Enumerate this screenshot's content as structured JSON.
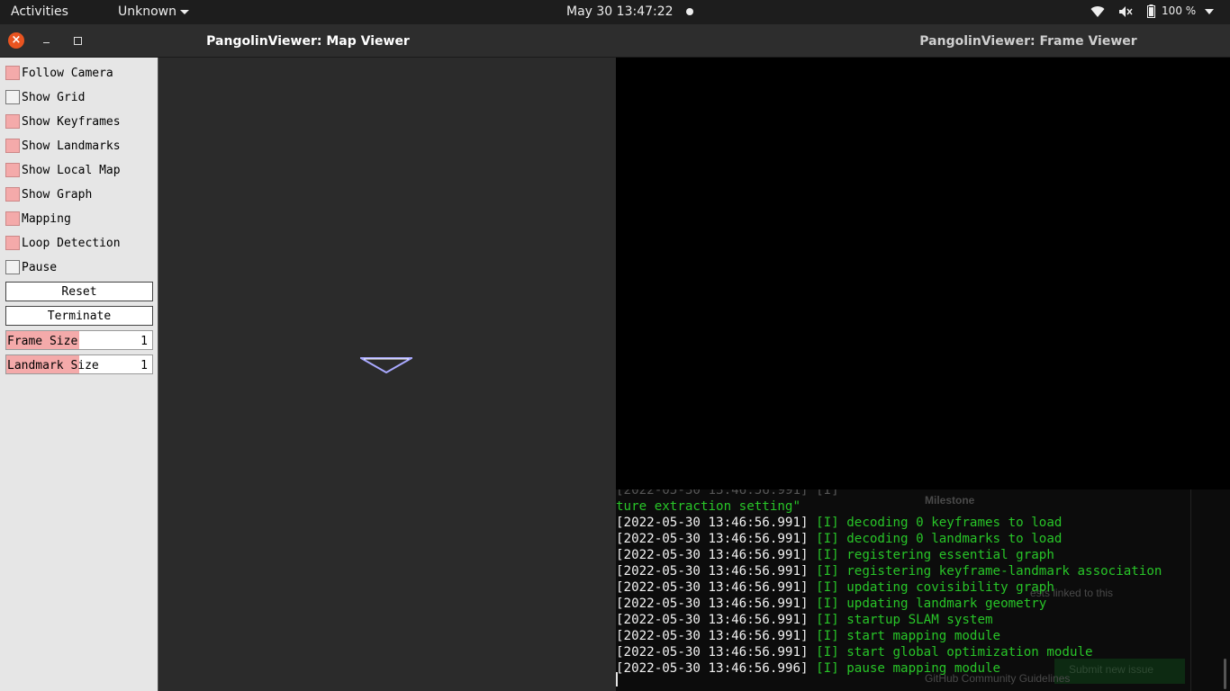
{
  "topbar": {
    "activities": "Activities",
    "app_menu": "Unknown",
    "clock": "May 30  13:47:22",
    "battery_percent": "100 %"
  },
  "map_viewer": {
    "title": "PangolinViewer: Map Viewer",
    "checkboxes": [
      {
        "label": "Follow Camera",
        "checked": true
      },
      {
        "label": "Show Grid",
        "checked": false
      },
      {
        "label": "Show Keyframes",
        "checked": true
      },
      {
        "label": "Show Landmarks",
        "checked": true
      },
      {
        "label": "Show Local Map",
        "checked": true
      },
      {
        "label": "Show Graph",
        "checked": true
      },
      {
        "label": "Mapping",
        "checked": true
      },
      {
        "label": "Loop Detection",
        "checked": true
      },
      {
        "label": "Pause",
        "checked": false
      }
    ],
    "buttons": {
      "reset": "Reset",
      "terminate": "Terminate"
    },
    "sliders": [
      {
        "label": "Frame Size",
        "value": "1",
        "fill": 0.5
      },
      {
        "label": "Landmark Size",
        "value": "1",
        "fill": 0.5
      }
    ],
    "colors": {
      "checked": "#f4aaaa",
      "camera": "#a9a9ff"
    }
  },
  "frame_viewer": {
    "title": "PangolinViewer: Frame Viewer"
  },
  "terminal": {
    "partial": "ture extraction setting\"",
    "lines": [
      {
        "ts": "[2022-05-30 13:46:56.991]",
        "msg": "[I] decoding 0 keyframes to load"
      },
      {
        "ts": "[2022-05-30 13:46:56.991]",
        "msg": "[I] decoding 0 landmarks to load"
      },
      {
        "ts": "[2022-05-30 13:46:56.991]",
        "msg": "[I] registering essential graph"
      },
      {
        "ts": "[2022-05-30 13:46:56.991]",
        "msg": "[I] registering keyframe-landmark association"
      },
      {
        "ts": "[2022-05-30 13:46:56.991]",
        "msg": "[I] updating covisibility graph"
      },
      {
        "ts": "[2022-05-30 13:46:56.991]",
        "msg": "[I] updating landmark geometry"
      },
      {
        "ts": "[2022-05-30 13:46:56.991]",
        "msg": "[I] startup SLAM system"
      },
      {
        "ts": "[2022-05-30 13:46:56.991]",
        "msg": "[I] start mapping module"
      },
      {
        "ts": "[2022-05-30 13:46:56.991]",
        "msg": "[I] start global optimization module"
      },
      {
        "ts": "[2022-05-30 13:46:56.996]",
        "msg": "[I] pause mapping module"
      }
    ],
    "ghost": {
      "milestone": "Milestone",
      "linked": "ests linked to this",
      "guidelines": "GitHub Community Guidelines",
      "button": "Submit new issue"
    },
    "colors": {
      "timestamp": "#f2f2f2",
      "message": "#28c528"
    }
  }
}
